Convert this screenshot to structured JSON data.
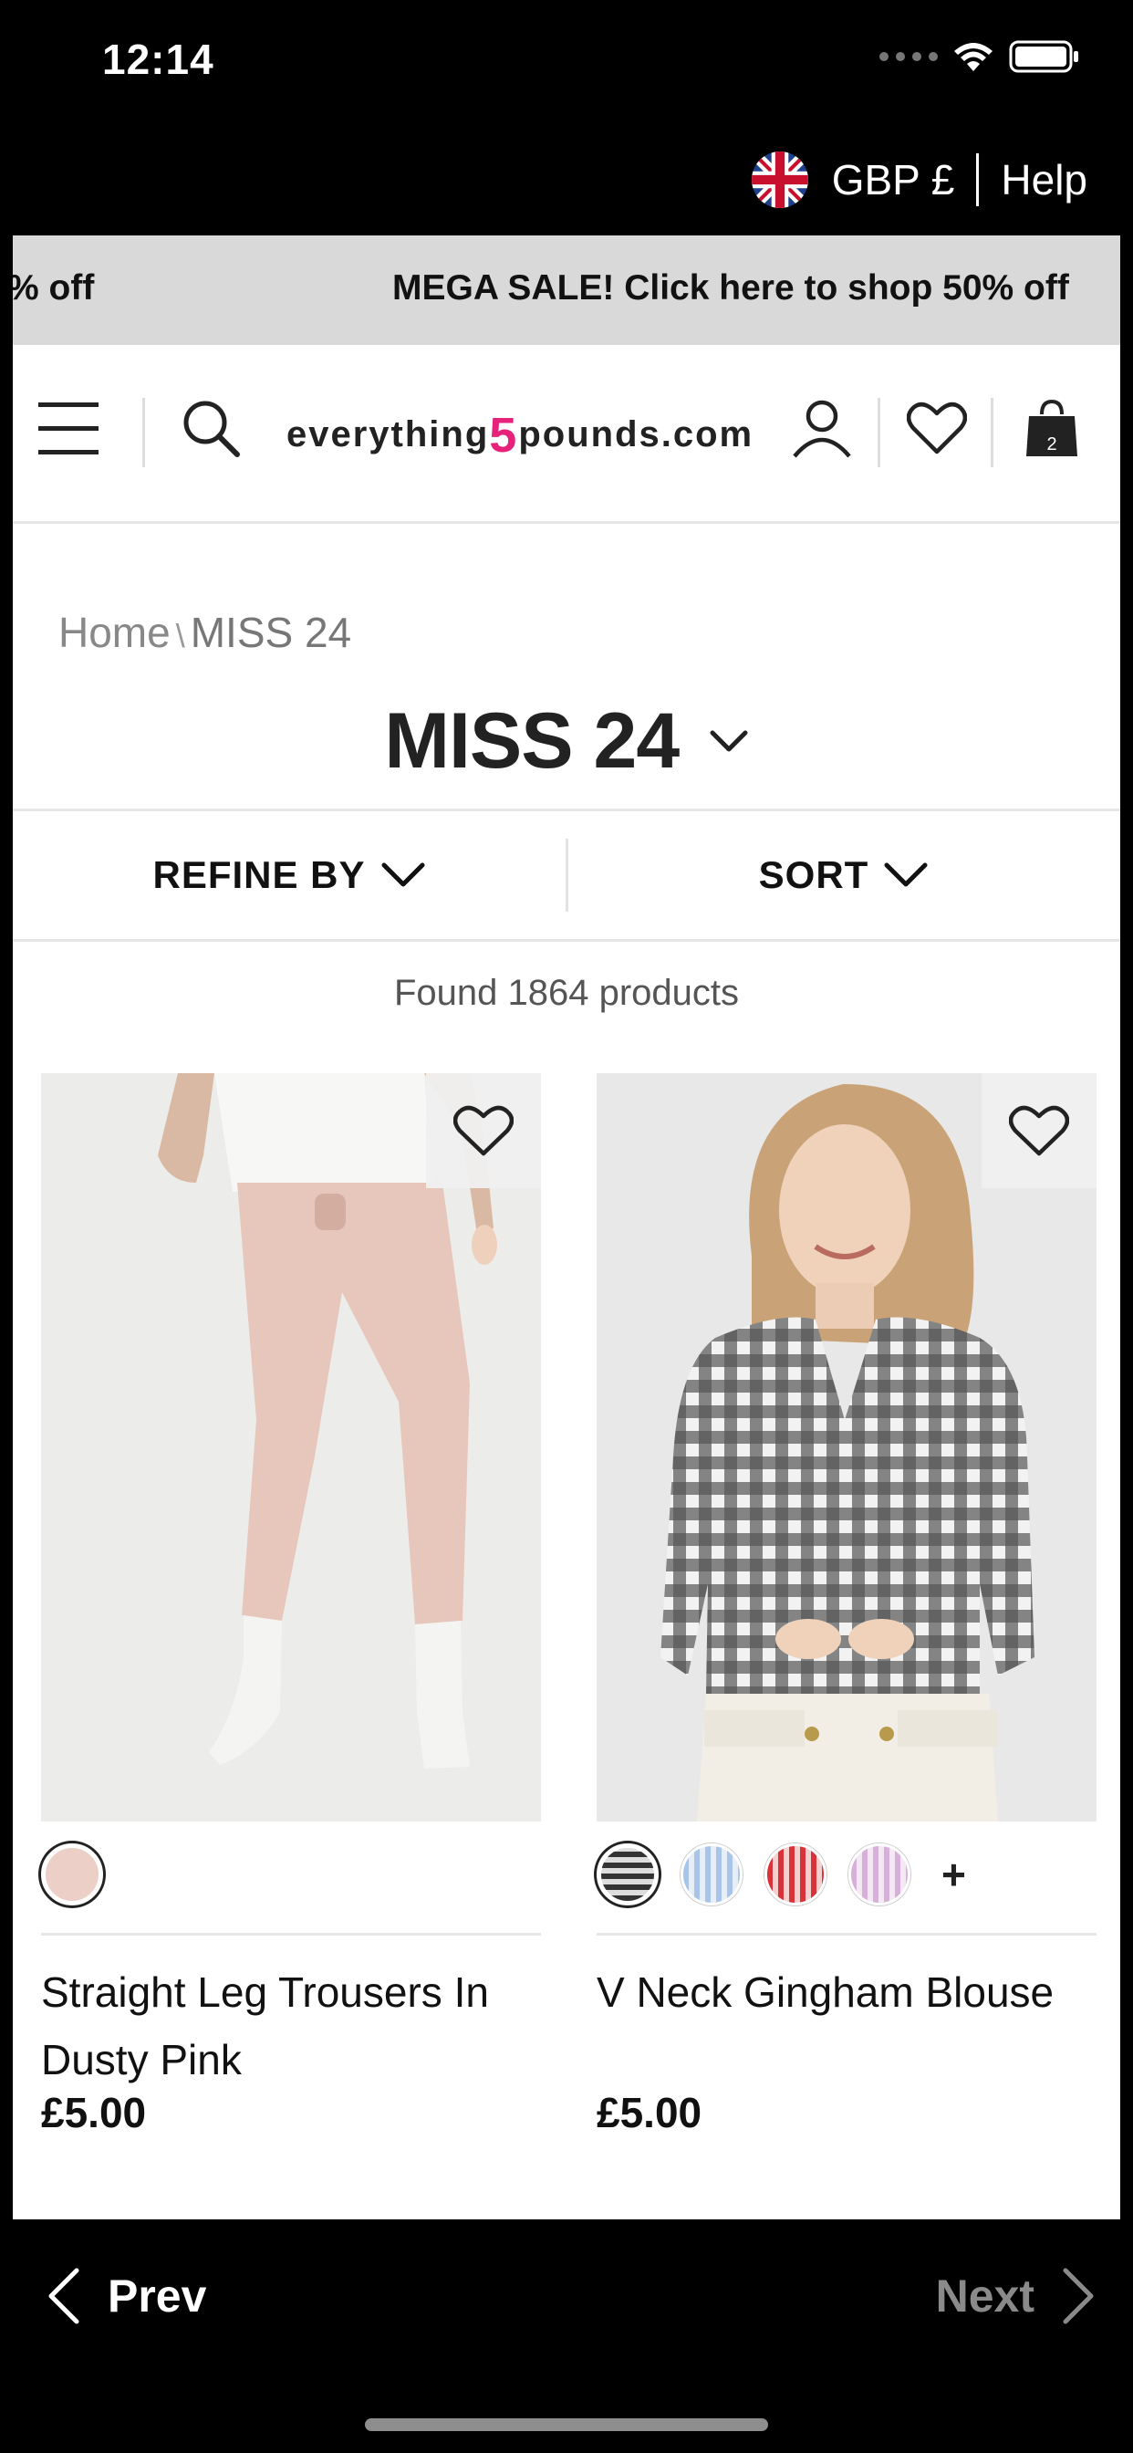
{
  "status": {
    "time": "12:14"
  },
  "utility": {
    "currency": "GBP £",
    "help": "Help"
  },
  "promo": {
    "left_fragment": "% off",
    "text": "MEGA SALE! Click here to shop 50% off"
  },
  "header": {
    "logo_left": "everything",
    "logo_five": "5",
    "logo_right": "pounds.com",
    "bag_count": "2"
  },
  "breadcrumb": {
    "home": "Home",
    "separator": "\\",
    "current": "MISS 24"
  },
  "page": {
    "title": "MISS 24",
    "found_text": "Found 1864 products"
  },
  "filters": {
    "refine_label": "REFINE BY",
    "sort_label": "SORT"
  },
  "products": [
    {
      "name": "Straight Leg Trousers In Dusty Pink",
      "price": "£5.00",
      "swatches": [
        "#eccfc6"
      ]
    },
    {
      "name": "V Neck Gingham Blouse",
      "price": "£5.00",
      "swatches": [
        "#3a3a3a",
        "#a8c4e8",
        "#d9333a",
        "#d6b0d8"
      ],
      "more": "+"
    }
  ],
  "bottom_nav": {
    "prev": "Prev",
    "next": "Next"
  },
  "colors": {
    "brand_pink": "#e6227a",
    "promo_bg": "#d9d9d9"
  }
}
